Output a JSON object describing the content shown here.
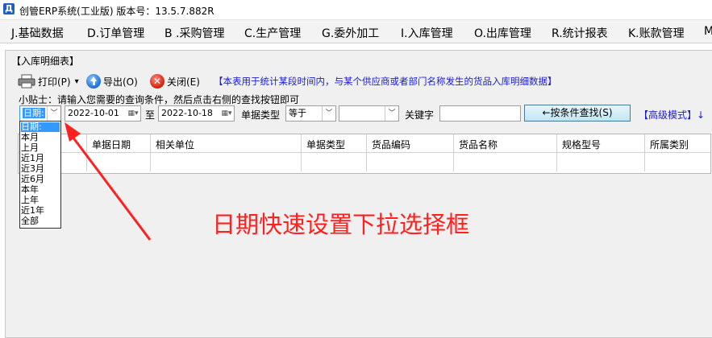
{
  "window": {
    "title": "创管ERP系统(工业版) 版本号：13.5.7.882R",
    "app_icon_letter": "Д"
  },
  "menu": [
    "J.基础数据",
    "D.订单管理",
    "B .采购管理",
    "C.生产管理",
    "G.委外加工",
    "I.入库管理",
    "O.出库管理",
    "R.统计报表",
    "K.账款管理",
    "M"
  ],
  "panel": {
    "title": "【入库明细表】"
  },
  "toolbar": {
    "print_label": "打印(P)",
    "print_dropdown": "▾",
    "export_label": "导出(O)",
    "close_label": "关闭(E)",
    "notice": "【本表用于统计某段时间内，与某个供应商或者部门名称发生的货品入库明细数据】"
  },
  "tip": "小贴士：请输入您需要的查询条件，然后点击右侧的查找按钮即可",
  "filter": {
    "date_type_value": "日期:",
    "date_from": "2022-10-01",
    "to_label": "至",
    "date_to": "2022-10-18",
    "doc_type_label": "单据类型",
    "operator_value": "等于",
    "doc_type_value": "",
    "keyword_label": "关键字",
    "keyword_value": "",
    "search_button": "←按条件查找(S)",
    "advanced_link": "【高级模式】↓"
  },
  "grid": {
    "columns": [
      "单据日期",
      "相关单位",
      "单据类型",
      "货品编码",
      "货品名称",
      "规格型号",
      "所属类别"
    ]
  },
  "date_dropdown": {
    "options": [
      "日期:",
      "本月",
      "上月",
      "近1月",
      "近3月",
      "近6月",
      "本年",
      "上年",
      "近1年",
      "全部"
    ],
    "selected_index": 0
  },
  "annotation": {
    "text": "日期快速设置下拉选择框",
    "color": "#ff2020"
  }
}
